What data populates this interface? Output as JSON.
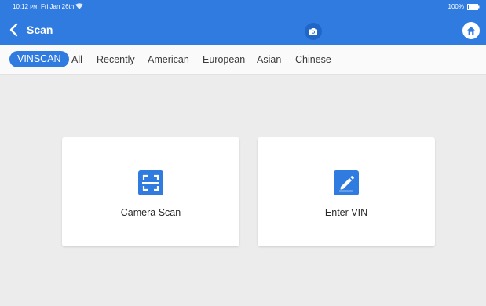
{
  "status_bar": {
    "time": "10:12",
    "ampm": "PM",
    "date": "Fri Jan 26th",
    "battery": "100%"
  },
  "header": {
    "title": "Scan",
    "back_icon": "chevron-left-icon",
    "camera_icon": "camera-icon",
    "home_icon": "home-icon"
  },
  "tabs": [
    {
      "label": "VINSCAN",
      "active": true
    },
    {
      "label": "All",
      "active": false
    },
    {
      "label": "Recently",
      "active": false
    },
    {
      "label": "American",
      "active": false
    },
    {
      "label": "European",
      "active": false
    },
    {
      "label": "Asian",
      "active": false
    },
    {
      "label": "Chinese",
      "active": false
    }
  ],
  "cards": [
    {
      "label": "Camera Scan",
      "icon": "scan-frame-icon"
    },
    {
      "label": "Enter VIN",
      "icon": "edit-pencil-icon"
    }
  ],
  "colors": {
    "primary": "#2f7be0",
    "background": "#ececec",
    "card": "#ffffff"
  }
}
